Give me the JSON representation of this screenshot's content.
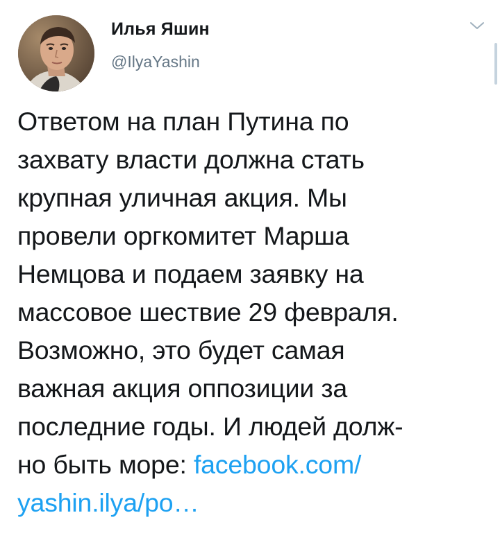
{
  "user": {
    "display_name": "Илья Яшин",
    "handle": "@IlyaYashin"
  },
  "tweet": {
    "lines": [
      "Ответом на план Путина по",
      "захвату власти должна стать",
      "крупная уличная акция. Мы",
      "провели оргкомитет Марша",
      "Немцова и подаем заявку на",
      "массовое шествие 29 февраля.",
      "Возможно, это будет самая",
      "важная акция оппозиции за",
      "последние годы. И людей долж-"
    ],
    "last_line_text": "но быть море: ",
    "link_part1": "facebook.com/",
    "link_part2": "yashin.ilya/po…"
  },
  "colors": {
    "text": "#14171a",
    "secondary": "#657786",
    "link": "#1da1f2"
  },
  "icons": {
    "menu": "chevron-down-icon",
    "avatar": "profile-photo"
  }
}
